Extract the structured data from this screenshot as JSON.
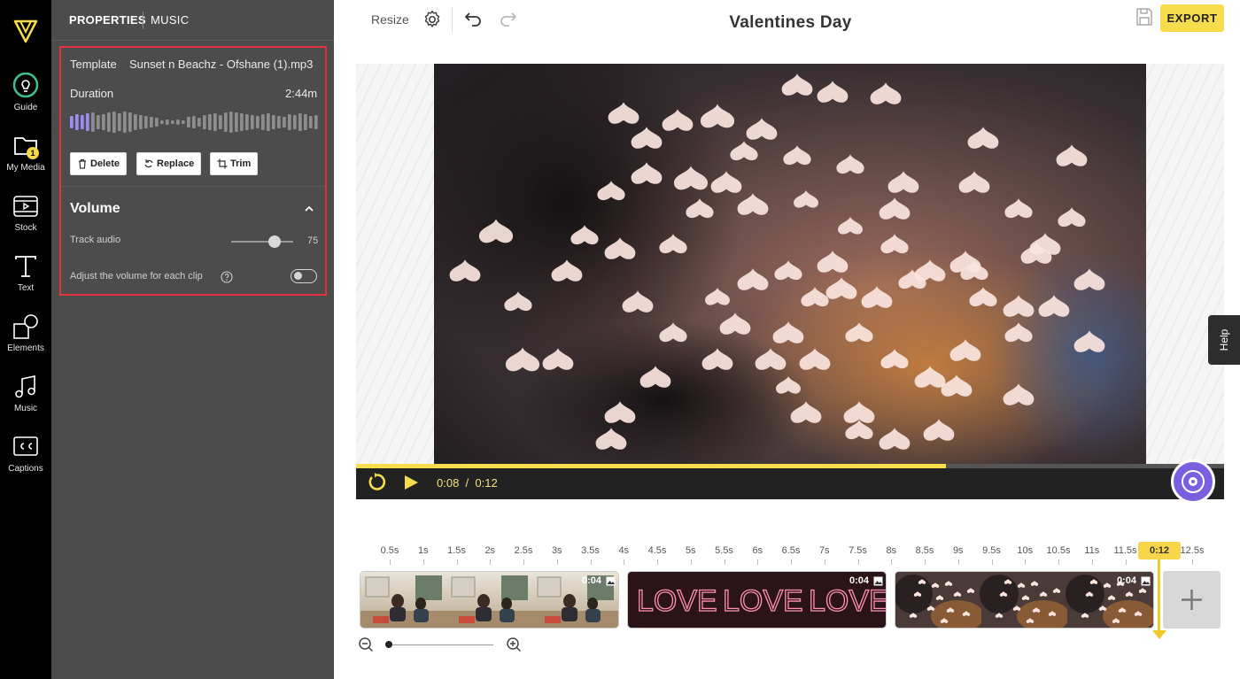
{
  "rail": {
    "items": [
      {
        "label": "Guide",
        "icon": "lightbulb-icon"
      },
      {
        "label": "My Media",
        "icon": "folder-icon",
        "badge": "1"
      },
      {
        "label": "Stock",
        "icon": "film-icon"
      },
      {
        "label": "Text",
        "icon": "text-icon"
      },
      {
        "label": "Elements",
        "icon": "shapes-icon"
      },
      {
        "label": "Music",
        "icon": "music-note-icon"
      },
      {
        "label": "Captions",
        "icon": "captions-icon"
      }
    ]
  },
  "panel": {
    "tabs": [
      "PROPERTIES",
      "MUSIC"
    ],
    "template_label": "Template",
    "template_value": "Sunset n Beachz - Ofshane (1).mp3",
    "duration_label": "Duration",
    "duration_value": "2:44m",
    "buttons": {
      "delete": "Delete",
      "replace": "Replace",
      "trim": "Trim"
    },
    "volume_title": "Volume",
    "track_audio_label": "Track audio",
    "track_audio_value": "75",
    "adjust_label": "Adjust the volume for each clip"
  },
  "topbar": {
    "resize": "Resize",
    "title": "Valentines Day",
    "export": "EXPORT"
  },
  "player": {
    "current": "0:08",
    "separator": "/",
    "total": "0:12",
    "progress": 0.68
  },
  "help": "Help",
  "timeline": {
    "ticks": [
      "0.5s",
      "1s",
      "1.5s",
      "2s",
      "2.5s",
      "3s",
      "3.5s",
      "4s",
      "4.5s",
      "5s",
      "5.5s",
      "6s",
      "6.5s",
      "7s",
      "7.5s",
      "8s",
      "8.5s",
      "9s",
      "9.5s",
      "10s",
      "10.5s",
      "11s",
      "11.5s",
      "12s",
      "12.5s"
    ],
    "playhead": "0:12",
    "clips": [
      {
        "duration": "0:04",
        "kind": "people"
      },
      {
        "duration": "0:04",
        "kind": "love"
      },
      {
        "duration": "0:04",
        "kind": "hearts"
      }
    ]
  },
  "colors": {
    "accent": "#f7dc4b",
    "highlight_border": "#e5333e",
    "panel_bg": "#4c4c4c",
    "rail_bg": "#000000"
  }
}
